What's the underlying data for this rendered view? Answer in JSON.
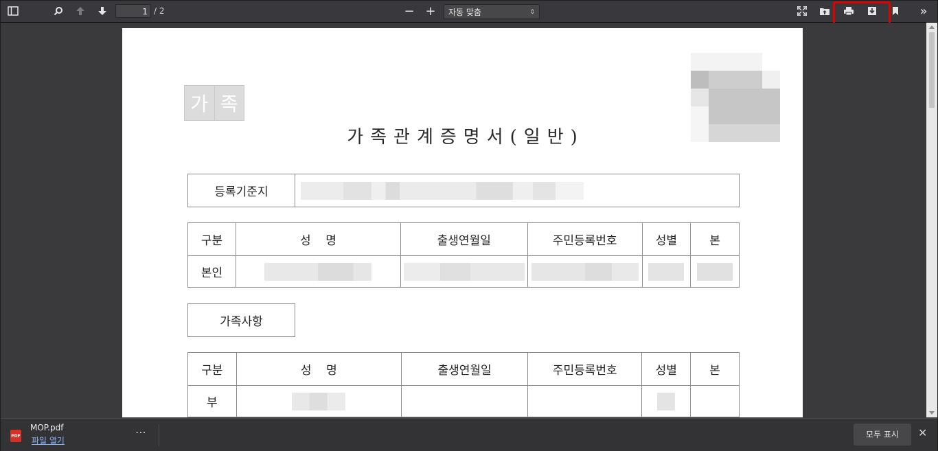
{
  "toolbar": {
    "page_current": "1",
    "page_count": "/ 2",
    "zoom_value": "자동 맞춤",
    "zoom_caret": "⇕",
    "zoom_out": "−",
    "zoom_in": "+",
    "more_tools": "»"
  },
  "document": {
    "stamp": [
      "가",
      "족"
    ],
    "title": "가족관계증명서(일반)",
    "registry_label": "등록기준지",
    "headers": [
      "구분",
      "성    명",
      "출생연월일",
      "주민등록번호",
      "성별",
      "본"
    ],
    "self_label": "본인",
    "family_section_label": "가족사항",
    "family_first_label": "부"
  },
  "download_bar": {
    "file_icon_text": "PDF",
    "file_name": "MOP.pdf",
    "open_link": "파일 열기",
    "more_label": "⋯",
    "show_all": "모두 표시",
    "close_label": "✕"
  },
  "colors": {
    "toolbar_bg": "#38383d",
    "viewer_bg": "#3a3a3c",
    "highlight": "#e00000",
    "link": "#8ab4f8"
  },
  "icons": [
    "sidebar-toggle-icon",
    "search-icon",
    "arrow-up-icon",
    "arrow-down-icon",
    "minus-icon",
    "plus-icon",
    "presentation-mode-icon",
    "open-file-icon",
    "print-icon",
    "download-icon",
    "bookmark-icon",
    "double-chevron-right-icon"
  ]
}
